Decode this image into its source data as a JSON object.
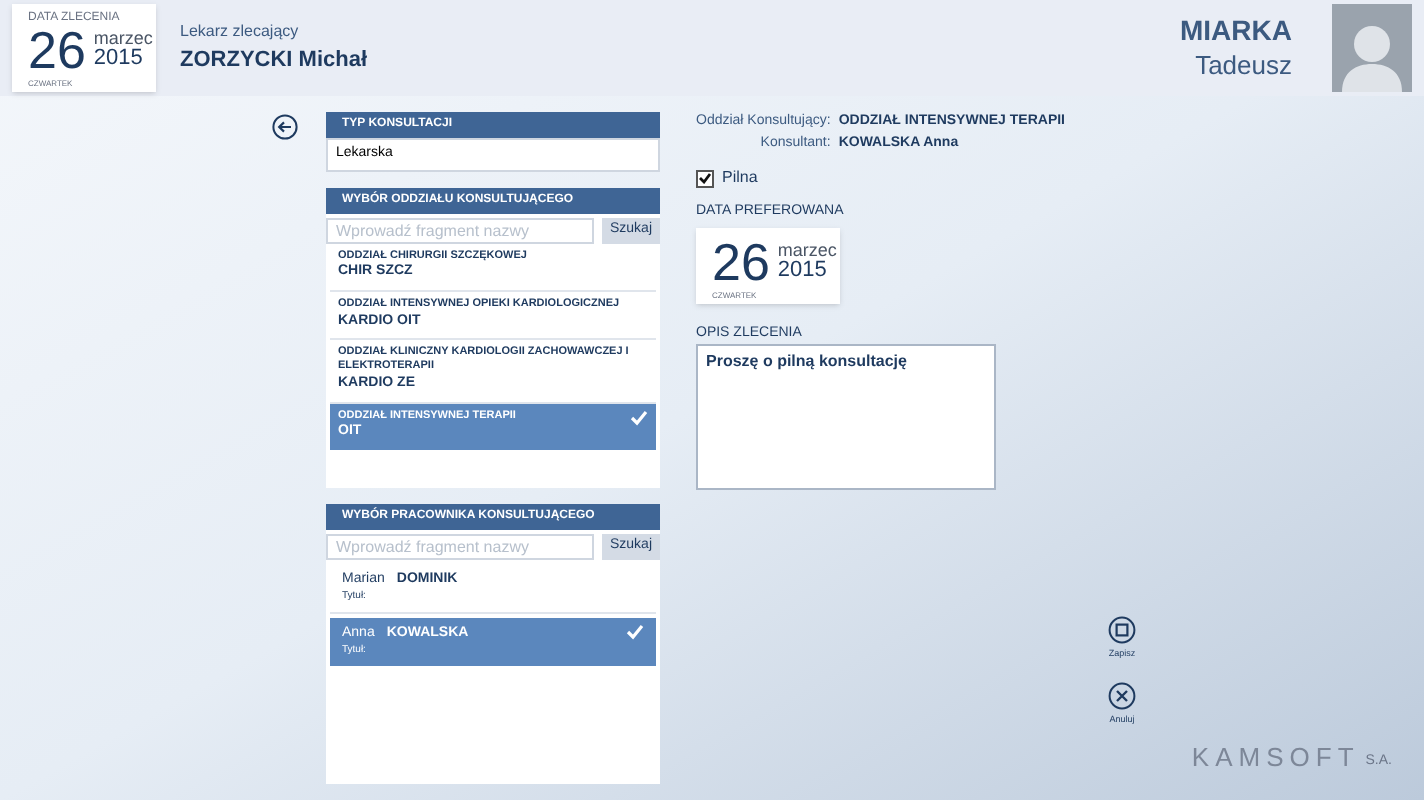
{
  "header": {
    "order_date": {
      "label": "DATA ZLECENIA",
      "day": "26",
      "month": "marzec",
      "year": "2015",
      "weekday": "CZWARTEK"
    },
    "doctor_label": "Lekarz zlecający",
    "doctor_name": "ZORZYCKI Michał",
    "patient": {
      "surname": "MIARKA",
      "first_name": "Tadeusz"
    }
  },
  "consultation_type": {
    "title": "TYP KONSULTACJI",
    "value": "Lekarska"
  },
  "department": {
    "title": "WYBÓR ODDZIAŁU KONSULTUJĄCEGO",
    "placeholder": "Wprowadź fragment nazwy",
    "search_button": "Szukaj",
    "items": [
      {
        "name": "ODDZIAŁ CHIRURGII SZCZĘKOWEJ",
        "code": "CHIR SZCZ",
        "selected": false
      },
      {
        "name": "ODDZIAŁ INTENSYWNEJ OPIEKI KARDIOLOGICZNEJ",
        "code": "KARDIO OIT",
        "selected": false
      },
      {
        "name": "ODDZIAŁ KLINICZNY KARDIOLOGII ZACHOWAWCZEJ I ELEKTROTERAPII",
        "code": "KARDIO ZE",
        "selected": false
      },
      {
        "name": "ODDZIAŁ INTENSYWNEJ TERAPII",
        "code": "OIT",
        "selected": true
      }
    ]
  },
  "employee": {
    "title": "WYBÓR PRACOWNIKA KONSULTUJĄCEGO",
    "placeholder": "Wprowadź fragment nazwy",
    "search_button": "Szukaj",
    "items": [
      {
        "first_name": "Marian",
        "surname": "DOMINIK",
        "title_label": "Tytuł:",
        "selected": false
      },
      {
        "first_name": "Anna",
        "surname": "KOWALSKA",
        "title_label": "Tytuł:",
        "selected": true
      }
    ]
  },
  "summary": {
    "department_label": "Oddział Konsultujący:",
    "department_value": "ODDZIAŁ INTENSYWNEJ TERAPII",
    "consultant_label": "Konsultant:",
    "consultant_value": "KOWALSKA Anna"
  },
  "urgent": {
    "label": "Pilna",
    "checked": true
  },
  "preferred_date": {
    "label": "DATA PREFEROWANA",
    "day": "26",
    "month": "marzec",
    "year": "2015",
    "weekday": "CZWARTEK"
  },
  "description": {
    "label": "OPIS ZLECENIA",
    "value": "Proszę o pilną konsultację"
  },
  "actions": [
    {
      "kind": "save",
      "label": "Zapisz"
    },
    {
      "kind": "cancel",
      "label": "Anuluj"
    }
  ],
  "brand": {
    "name": "KAMSOFT",
    "suffix": "S.A."
  }
}
